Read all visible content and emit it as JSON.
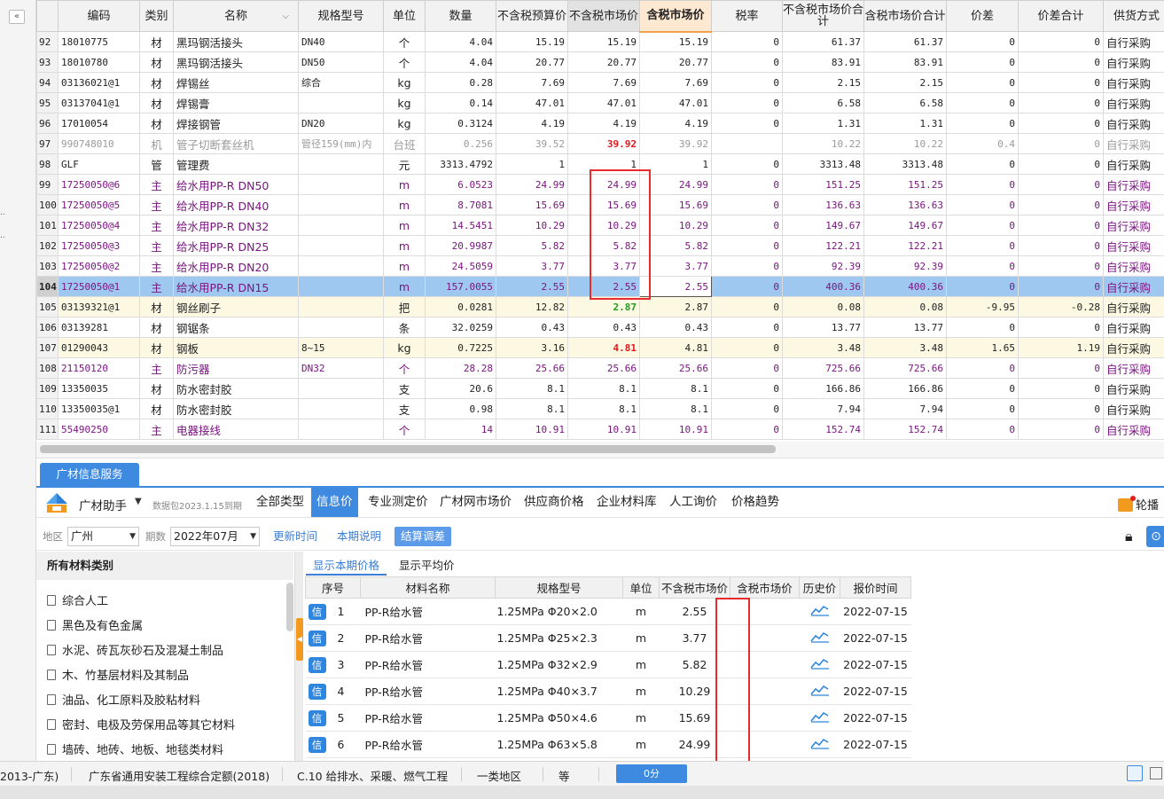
{
  "left_strip": {
    "collapse_glyph": "«",
    "dots": [
      "..",
      ".."
    ]
  },
  "grid": {
    "columns": [
      "编码",
      "类别",
      "名称",
      "规格型号",
      "单位",
      "数量",
      "不含税预算价",
      "不含税市场价",
      "含税市场价",
      "税率",
      "不含税市场价合计",
      "含税市场价合计",
      "价差",
      "价差合计",
      "供货方式"
    ],
    "rows": [
      {
        "idx": "92",
        "code": "18010775",
        "type": "材",
        "name": "黑玛钢活接头",
        "spec": "DN40",
        "unit": "个",
        "qty": "4.04",
        "budget": "15.19",
        "mkt": "15.19",
        "mkt_tax": "15.19",
        "rate": "0",
        "sum_mkt": "61.37",
        "sum_tax": "61.37",
        "diff": "0",
        "diff_sum": "0",
        "supply": "自行采购",
        "style": "normal"
      },
      {
        "idx": "93",
        "code": "18010780",
        "type": "材",
        "name": "黑玛钢活接头",
        "spec": "DN50",
        "unit": "个",
        "qty": "4.04",
        "budget": "20.77",
        "mkt": "20.77",
        "mkt_tax": "20.77",
        "rate": "0",
        "sum_mkt": "83.91",
        "sum_tax": "83.91",
        "diff": "0",
        "diff_sum": "0",
        "supply": "自行采购",
        "style": "normal"
      },
      {
        "idx": "94",
        "code": "03136021@1",
        "type": "材",
        "name": "焊锡丝",
        "spec": "综合",
        "unit": "kg",
        "qty": "0.28",
        "budget": "7.69",
        "mkt": "7.69",
        "mkt_tax": "7.69",
        "rate": "0",
        "sum_mkt": "2.15",
        "sum_tax": "2.15",
        "diff": "0",
        "diff_sum": "0",
        "supply": "自行采购",
        "style": "normal"
      },
      {
        "idx": "95",
        "code": "03137041@1",
        "type": "材",
        "name": "焊锡膏",
        "spec": "",
        "unit": "kg",
        "qty": "0.14",
        "budget": "47.01",
        "mkt": "47.01",
        "mkt_tax": "47.01",
        "rate": "0",
        "sum_mkt": "6.58",
        "sum_tax": "6.58",
        "diff": "0",
        "diff_sum": "0",
        "supply": "自行采购",
        "style": "normal"
      },
      {
        "idx": "96",
        "code": "17010054",
        "type": "材",
        "name": "焊接钢管",
        "spec": "DN20",
        "unit": "kg",
        "qty": "0.3124",
        "budget": "4.19",
        "mkt": "4.19",
        "mkt_tax": "4.19",
        "rate": "0",
        "sum_mkt": "1.31",
        "sum_tax": "1.31",
        "diff": "0",
        "diff_sum": "0",
        "supply": "自行采购",
        "style": "normal"
      },
      {
        "idx": "97",
        "code": "990748010",
        "type": "机",
        "name": "管子切断套丝机",
        "spec": "管径159(mm)内",
        "unit": "台班",
        "qty": "0.256",
        "budget": "39.52",
        "mkt": "39.92",
        "mkt_tax": "39.92",
        "rate": "",
        "sum_mkt": "10.22",
        "sum_tax": "10.22",
        "diff": "0.4",
        "diff_sum": "0",
        "supply": "自行采购",
        "style": "dim",
        "mkt_color": "red"
      },
      {
        "idx": "98",
        "code": "GLF",
        "type": "管",
        "name": "管理费",
        "spec": "",
        "unit": "元",
        "qty": "3313.4792",
        "budget": "1",
        "mkt": "1",
        "mkt_tax": "1",
        "rate": "0",
        "sum_mkt": "3313.48",
        "sum_tax": "3313.48",
        "diff": "0",
        "diff_sum": "0",
        "supply": "自行采购",
        "style": "normal"
      },
      {
        "idx": "99",
        "code": "17250050@6",
        "type": "主",
        "name": "给水用PP-R DN50",
        "spec": "",
        "unit": "m",
        "qty": "6.0523",
        "budget": "24.99",
        "mkt": "24.99",
        "mkt_tax": "24.99",
        "rate": "0",
        "sum_mkt": "151.25",
        "sum_tax": "151.25",
        "diff": "0",
        "diff_sum": "0",
        "supply": "自行采购",
        "style": "purple"
      },
      {
        "idx": "100",
        "code": "17250050@5",
        "type": "主",
        "name": "给水用PP-R DN40",
        "spec": "",
        "unit": "m",
        "qty": "8.7081",
        "budget": "15.69",
        "mkt": "15.69",
        "mkt_tax": "15.69",
        "rate": "0",
        "sum_mkt": "136.63",
        "sum_tax": "136.63",
        "diff": "0",
        "diff_sum": "0",
        "supply": "自行采购",
        "style": "purple"
      },
      {
        "idx": "101",
        "code": "17250050@4",
        "type": "主",
        "name": "给水用PP-R DN32",
        "spec": "",
        "unit": "m",
        "qty": "14.5451",
        "budget": "10.29",
        "mkt": "10.29",
        "mkt_tax": "10.29",
        "rate": "0",
        "sum_mkt": "149.67",
        "sum_tax": "149.67",
        "diff": "0",
        "diff_sum": "0",
        "supply": "自行采购",
        "style": "purple"
      },
      {
        "idx": "102",
        "code": "17250050@3",
        "type": "主",
        "name": "给水用PP-R DN25",
        "spec": "",
        "unit": "m",
        "qty": "20.9987",
        "budget": "5.82",
        "mkt": "5.82",
        "mkt_tax": "5.82",
        "rate": "0",
        "sum_mkt": "122.21",
        "sum_tax": "122.21",
        "diff": "0",
        "diff_sum": "0",
        "supply": "自行采购",
        "style": "purple"
      },
      {
        "idx": "103",
        "code": "17250050@2",
        "type": "主",
        "name": "给水用PP-R DN20",
        "spec": "",
        "unit": "m",
        "qty": "24.5059",
        "budget": "3.77",
        "mkt": "3.77",
        "mkt_tax": "3.77",
        "rate": "0",
        "sum_mkt": "92.39",
        "sum_tax": "92.39",
        "diff": "0",
        "diff_sum": "0",
        "supply": "自行采购",
        "style": "purple"
      },
      {
        "idx": "104",
        "code": "17250050@1",
        "type": "主",
        "name": "给水用PP-R DN15",
        "spec": "",
        "unit": "m",
        "qty": "157.0055",
        "budget": "2.55",
        "mkt": "2.55",
        "mkt_tax": "2.55",
        "rate": "0",
        "sum_mkt": "400.36",
        "sum_tax": "400.36",
        "diff": "0",
        "diff_sum": "0",
        "supply": "自行采购",
        "style": "purple selrow"
      },
      {
        "idx": "105",
        "code": "03139321@1",
        "type": "材",
        "name": "钢丝刷子",
        "spec": "",
        "unit": "把",
        "qty": "0.0281",
        "budget": "12.82",
        "mkt": "2.87",
        "mkt_tax": "2.87",
        "rate": "0",
        "sum_mkt": "0.08",
        "sum_tax": "0.08",
        "diff": "-9.95",
        "diff_sum": "-0.28",
        "supply": "自行采购",
        "style": "yellow",
        "mkt_color": "green"
      },
      {
        "idx": "106",
        "code": "03139281",
        "type": "材",
        "name": "钢锯条",
        "spec": "",
        "unit": "条",
        "qty": "32.0259",
        "budget": "0.43",
        "mkt": "0.43",
        "mkt_tax": "0.43",
        "rate": "0",
        "sum_mkt": "13.77",
        "sum_tax": "13.77",
        "diff": "0",
        "diff_sum": "0",
        "supply": "自行采购",
        "style": "normal"
      },
      {
        "idx": "107",
        "code": "01290043",
        "type": "材",
        "name": "钢板",
        "spec": "8~15",
        "unit": "kg",
        "qty": "0.7225",
        "budget": "3.16",
        "mkt": "4.81",
        "mkt_tax": "4.81",
        "rate": "0",
        "sum_mkt": "3.48",
        "sum_tax": "3.48",
        "diff": "1.65",
        "diff_sum": "1.19",
        "supply": "自行采购",
        "style": "yellow",
        "mkt_color": "red"
      },
      {
        "idx": "108",
        "code": "21150120",
        "type": "主",
        "name": "防污器",
        "spec": "DN32",
        "unit": "个",
        "qty": "28.28",
        "budget": "25.66",
        "mkt": "25.66",
        "mkt_tax": "25.66",
        "rate": "0",
        "sum_mkt": "725.66",
        "sum_tax": "725.66",
        "diff": "0",
        "diff_sum": "0",
        "supply": "自行采购",
        "style": "purple"
      },
      {
        "idx": "109",
        "code": "13350035",
        "type": "材",
        "name": "防水密封胶",
        "spec": "",
        "unit": "支",
        "qty": "20.6",
        "budget": "8.1",
        "mkt": "8.1",
        "mkt_tax": "8.1",
        "rate": "0",
        "sum_mkt": "166.86",
        "sum_tax": "166.86",
        "diff": "0",
        "diff_sum": "0",
        "supply": "自行采购",
        "style": "normal"
      },
      {
        "idx": "110",
        "code": "13350035@1",
        "type": "材",
        "name": "防水密封胶",
        "spec": "",
        "unit": "支",
        "qty": "0.98",
        "budget": "8.1",
        "mkt": "8.1",
        "mkt_tax": "8.1",
        "rate": "0",
        "sum_mkt": "7.94",
        "sum_tax": "7.94",
        "diff": "0",
        "diff_sum": "0",
        "supply": "自行采购",
        "style": "normal"
      },
      {
        "idx": "111",
        "code": "55490250",
        "type": "主",
        "name": "电器接线",
        "spec": "",
        "unit": "个",
        "qty": "14",
        "budget": "10.91",
        "mkt": "10.91",
        "mkt_tax": "10.91",
        "rate": "0",
        "sum_mkt": "152.74",
        "sum_tax": "152.74",
        "diff": "0",
        "diff_sum": "0",
        "supply": "自行采购",
        "style": "purple"
      }
    ]
  },
  "panel": {
    "tab_label": "广材信息服务",
    "brand": "广材助手",
    "package": "数据包2023.1.15到期",
    "tabs": [
      "全部类型",
      "信息价",
      "专业测定价",
      "广材网市场价",
      "供应商价格",
      "企业材料库",
      "人工询价",
      "价格趋势"
    ],
    "carousel": "轮播",
    "filter": {
      "region_label": "地区",
      "region_value": "广州",
      "period_label": "期数",
      "period_value": "2022年07月",
      "update_time": "更新时间",
      "period_note": "本期说明",
      "settle": "结算调差"
    },
    "categories_title": "所有材料类别",
    "categories": [
      "综合人工",
      "黑色及有色金属",
      "水泥、砖瓦灰砂石及混凝土制品",
      "木、竹基层材料及其制品",
      "油品、化工原料及胶粘材料",
      "密封、电极及劳保用品等其它材料",
      "墙砖、地砖、地板、地毯类材料"
    ],
    "price_tabs": [
      "显示本期价格",
      "显示平均价"
    ],
    "price_columns": [
      "序号",
      "材料名称",
      "规格型号",
      "单位",
      "不含税市场价",
      "含税市场价",
      "历史价",
      "报价时间"
    ],
    "price_rows": [
      {
        "badge": "信",
        "no": "1",
        "name": "PP-R给水管",
        "spec": "1.25MPa Φ20×2.0",
        "unit": "m",
        "price": "2.55",
        "price_tax": "",
        "date": "2022-07-15"
      },
      {
        "badge": "信",
        "no": "2",
        "name": "PP-R给水管",
        "spec": "1.25MPa Φ25×2.3",
        "unit": "m",
        "price": "3.77",
        "price_tax": "",
        "date": "2022-07-15"
      },
      {
        "badge": "信",
        "no": "3",
        "name": "PP-R给水管",
        "spec": "1.25MPa Φ32×2.9",
        "unit": "m",
        "price": "5.82",
        "price_tax": "",
        "date": "2022-07-15"
      },
      {
        "badge": "信",
        "no": "4",
        "name": "PP-R给水管",
        "spec": "1.25MPa Φ40×3.7",
        "unit": "m",
        "price": "10.29",
        "price_tax": "",
        "date": "2022-07-15"
      },
      {
        "badge": "信",
        "no": "5",
        "name": "PP-R给水管",
        "spec": "1.25MPa Φ50×4.6",
        "unit": "m",
        "price": "15.69",
        "price_tax": "",
        "date": "2022-07-15"
      },
      {
        "badge": "信",
        "no": "6",
        "name": "PP-R给水管",
        "spec": "1.25MPa Φ63×5.8",
        "unit": "m",
        "price": "24.99",
        "price_tax": "",
        "date": "2022-07-15"
      }
    ]
  },
  "status": {
    "items": [
      "2013-广东)",
      "广东省通用安装工程综合定额(2018)",
      "C.10 给排水、采暖、燃气工程",
      "一类地区",
      "等"
    ],
    "progress": "0分"
  },
  "colors": {
    "accent": "#3d8ae0",
    "highlight_box": "#e62c2c",
    "purple_text": "#7a1680",
    "selected_row": "#9fc8f1"
  }
}
